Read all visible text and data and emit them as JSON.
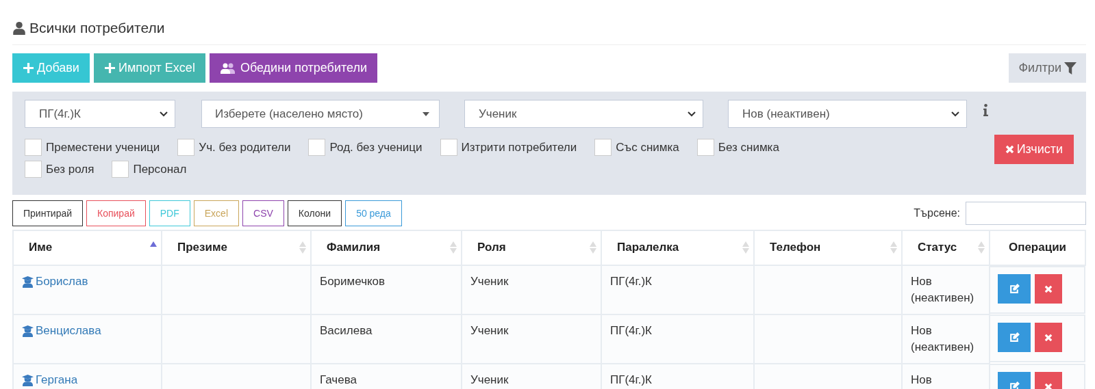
{
  "title": "Всички потребители",
  "actions": [
    {
      "label": "Добави",
      "kind": "add"
    },
    {
      "label": "Импорт Excel",
      "kind": "import"
    },
    {
      "label": "Обедини потребители",
      "kind": "merge"
    }
  ],
  "filters_button": {
    "label": "Филтри"
  },
  "selects": [
    {
      "value": "ПГ(4г.)К",
      "kind": "native"
    },
    {
      "value": "Изберете (населено място)",
      "kind": "searchable"
    },
    {
      "value": "Ученик",
      "kind": "native"
    },
    {
      "value": "Нов (неактивен)",
      "kind": "native"
    }
  ],
  "checkboxes": [
    {
      "label": "Преместени ученици",
      "checked": false
    },
    {
      "label": "Уч. без родители",
      "checked": false
    },
    {
      "label": "Род. без ученици",
      "checked": false
    },
    {
      "label": "Изтрити потребители",
      "checked": false
    },
    {
      "label": "Със снимка",
      "checked": false
    },
    {
      "label": "Без снимка",
      "checked": false
    },
    {
      "label": "Без роля",
      "checked": false
    },
    {
      "label": "Персонал",
      "checked": false
    }
  ],
  "clear_button": {
    "label": "Изчисти"
  },
  "export_buttons": [
    {
      "label": "Принтирай",
      "color": "#333333"
    },
    {
      "label": "Копирай",
      "color": "#e8505b"
    },
    {
      "label": "PDF",
      "color": "#3ec8d8"
    },
    {
      "label": "Excel",
      "color": "#c9a55a"
    },
    {
      "label": "CSV",
      "color": "#8e44ad"
    },
    {
      "label": "Колони",
      "color": "#333333"
    },
    {
      "label": "50 реда",
      "color": "#3a9ad9"
    }
  ],
  "search": {
    "label": "Търсене:"
  },
  "table": {
    "columns": [
      {
        "label": "Име",
        "sortable": true,
        "selected": true
      },
      {
        "label": "Презиме",
        "sortable": true,
        "selected": false
      },
      {
        "label": "Фамилия",
        "sortable": true,
        "selected": false
      },
      {
        "label": "Роля",
        "sortable": true,
        "selected": false
      },
      {
        "label": "Паралелка",
        "sortable": true,
        "selected": false
      },
      {
        "label": "Телефон",
        "sortable": true,
        "selected": false
      },
      {
        "label": "Статус",
        "sortable": true,
        "selected": false
      },
      {
        "label": "Операции",
        "sortable": false,
        "selected": false
      }
    ],
    "rows": [
      {
        "cells": [
          "Борислав",
          "",
          "Боримечков",
          "Ученик",
          "ПГ(4г.)К",
          "",
          "Нов (неактивен)"
        ]
      },
      {
        "cells": [
          "Венцислава",
          "",
          "Василева",
          "Ученик",
          "ПГ(4г.)К",
          "",
          "Нов (неактивен)"
        ]
      },
      {
        "cells": [
          "Гергана",
          "",
          "Гачева",
          "Ученик",
          "ПГ(4г.)К",
          "",
          "Нов"
        ]
      }
    ]
  }
}
